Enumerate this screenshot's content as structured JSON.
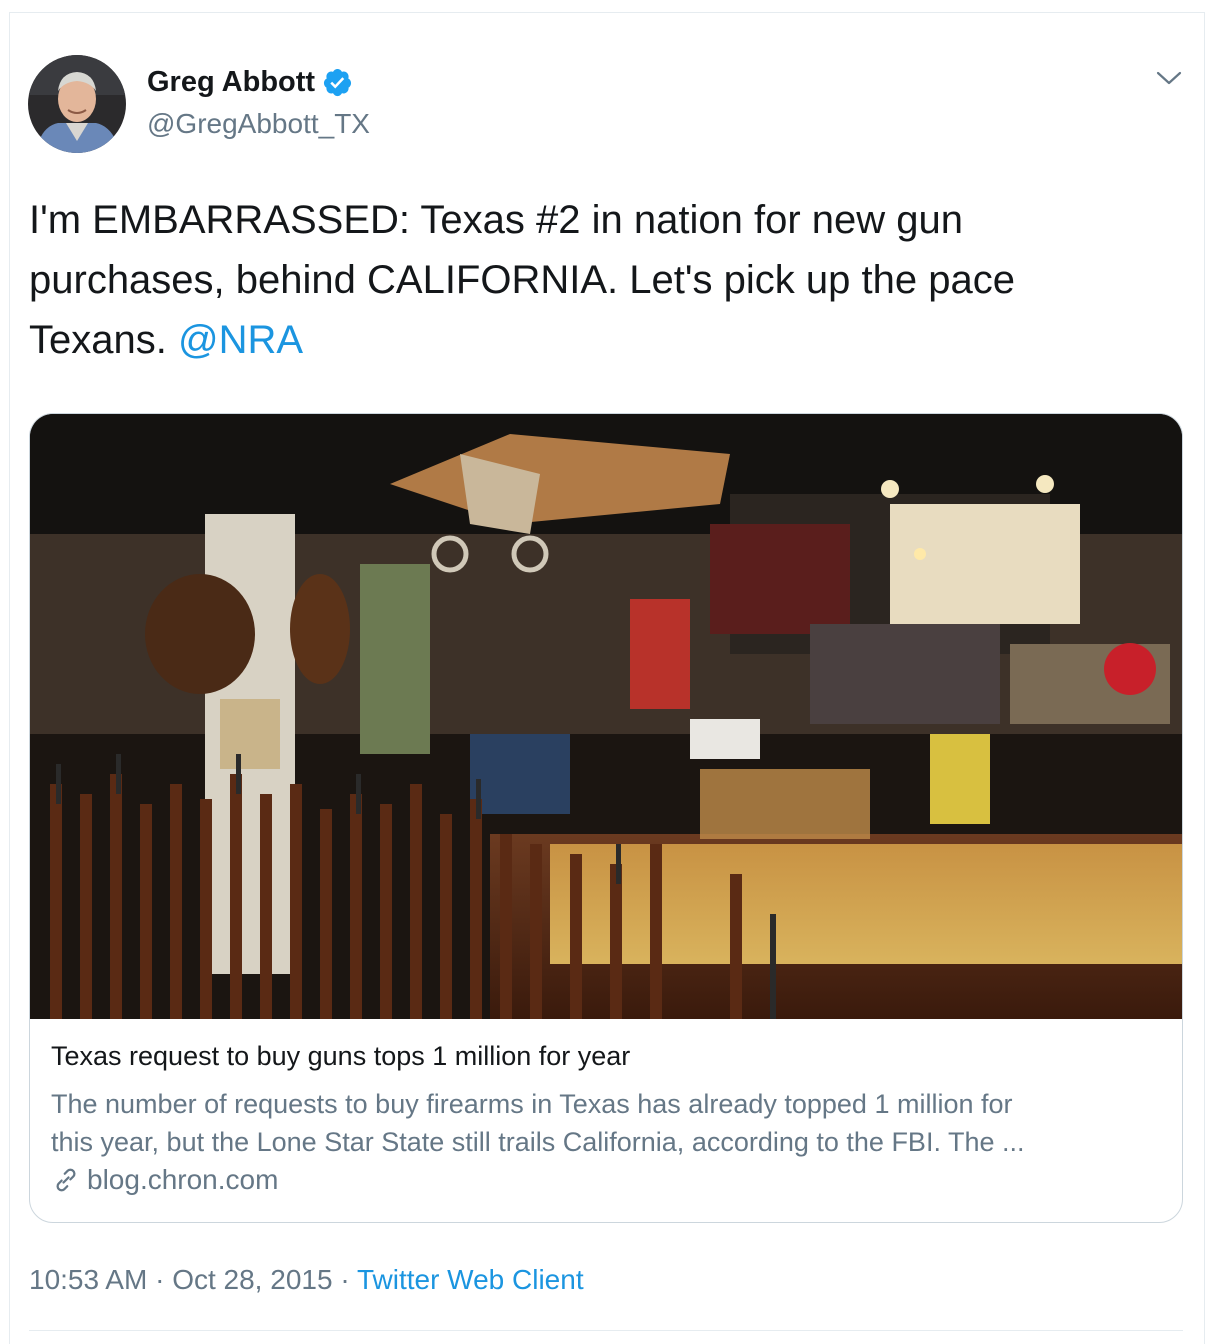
{
  "author": {
    "name": "Greg Abbott",
    "handle": "@GregAbbott_TX",
    "verified": true
  },
  "icons": {
    "verified": "verified-badge-icon",
    "menu": "chevron-down-icon",
    "link": "link-icon"
  },
  "tweet": {
    "text_plain": "I'm EMBARRASSED: Texas #2 in nation for new gun purchases, behind CALIFORNIA. Let's pick up the pace Texans.",
    "mention": "@NRA"
  },
  "card": {
    "title": "Texas request to buy guns tops 1 million for year",
    "description_line1": "The number of requests to buy firearms in Texas has already topped 1 million for",
    "description_line2": "this year, but the Lone Star State still trails California, according to the FBI. The ...",
    "domain": "blog.chron.com"
  },
  "meta": {
    "time": "10:53 AM",
    "separator": "·",
    "date": "Oct 28, 2015",
    "source": "Twitter Web Client"
  },
  "colors": {
    "link": "#1b95e0",
    "secondary_text": "#657786",
    "border": "#ccd6dd",
    "verified": "#1da1f2"
  }
}
